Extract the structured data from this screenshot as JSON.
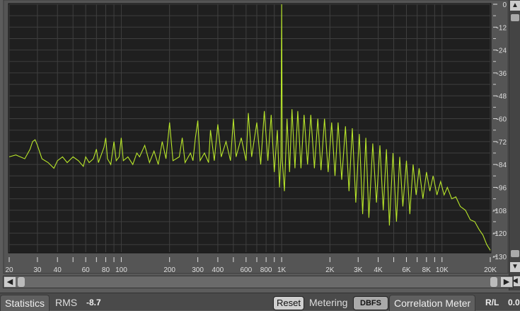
{
  "chart_data": {
    "type": "line",
    "title": "",
    "xscale": "log",
    "xlim": [
      20,
      20000
    ],
    "ylim": [
      -130,
      0
    ],
    "x_tick_labels": [
      {
        "v": 20,
        "t": "20"
      },
      {
        "v": 30,
        "t": "30"
      },
      {
        "v": 40,
        "t": "40"
      },
      {
        "v": 60,
        "t": "60"
      },
      {
        "v": 80,
        "t": "80"
      },
      {
        "v": 100,
        "t": "100"
      },
      {
        "v": 200,
        "t": "200"
      },
      {
        "v": 300,
        "t": "300"
      },
      {
        "v": 400,
        "t": "400"
      },
      {
        "v": 600,
        "t": "600"
      },
      {
        "v": 800,
        "t": "800"
      },
      {
        "v": 1000,
        "t": "1K"
      },
      {
        "v": 2000,
        "t": "2K"
      },
      {
        "v": 3000,
        "t": "3K"
      },
      {
        "v": 4000,
        "t": "4K"
      },
      {
        "v": 6000,
        "t": "6K"
      },
      {
        "v": 8000,
        "t": "8K"
      },
      {
        "v": 10000,
        "t": "10K"
      },
      {
        "v": 20000,
        "t": "20K"
      }
    ],
    "x_minor_ticks": [
      50,
      70,
      90,
      500,
      700,
      900,
      5000,
      7000,
      9000
    ],
    "y_tick_labels": [
      "0",
      "-12",
      "-24",
      "-36",
      "-48",
      "-60",
      "-72",
      "-84",
      "-96",
      "-108",
      "-120",
      "-130"
    ],
    "y_ticks": [
      0,
      -12,
      -24,
      -36,
      -48,
      -60,
      -72,
      -84,
      -96,
      -108,
      -120,
      -130
    ],
    "grid": true,
    "line_color": "#b8e62a",
    "series": [
      {
        "name": "spectrum",
        "points": [
          [
            20,
            -80
          ],
          [
            22,
            -79
          ],
          [
            25,
            -81
          ],
          [
            27,
            -76
          ],
          [
            28,
            -72
          ],
          [
            29,
            -71
          ],
          [
            30,
            -74
          ],
          [
            32,
            -81
          ],
          [
            35,
            -83
          ],
          [
            38,
            -86
          ],
          [
            40,
            -82
          ],
          [
            43,
            -80
          ],
          [
            46,
            -83
          ],
          [
            50,
            -80
          ],
          [
            54,
            -82
          ],
          [
            58,
            -85
          ],
          [
            60,
            -80
          ],
          [
            63,
            -83
          ],
          [
            67,
            -81
          ],
          [
            70,
            -76
          ],
          [
            72,
            -83
          ],
          [
            75,
            -79
          ],
          [
            78,
            -75
          ],
          [
            80,
            -70
          ],
          [
            82,
            -81
          ],
          [
            86,
            -84
          ],
          [
            90,
            -72
          ],
          [
            93,
            -82
          ],
          [
            97,
            -80
          ],
          [
            100,
            -70
          ],
          [
            103,
            -82
          ],
          [
            110,
            -80
          ],
          [
            118,
            -84
          ],
          [
            125,
            -78
          ],
          [
            130,
            -80
          ],
          [
            140,
            -74
          ],
          [
            150,
            -83
          ],
          [
            160,
            -77
          ],
          [
            170,
            -84
          ],
          [
            180,
            -72
          ],
          [
            190,
            -81
          ],
          [
            200,
            -62
          ],
          [
            210,
            -82
          ],
          [
            230,
            -80
          ],
          [
            240,
            -70
          ],
          [
            250,
            -83
          ],
          [
            270,
            -78
          ],
          [
            280,
            -82
          ],
          [
            290,
            -70
          ],
          [
            300,
            -61
          ],
          [
            310,
            -82
          ],
          [
            330,
            -78
          ],
          [
            350,
            -83
          ],
          [
            360,
            -66
          ],
          [
            380,
            -82
          ],
          [
            400,
            -63
          ],
          [
            420,
            -80
          ],
          [
            450,
            -72
          ],
          [
            480,
            -82
          ],
          [
            500,
            -60
          ],
          [
            520,
            -80
          ],
          [
            560,
            -70
          ],
          [
            600,
            -82
          ],
          [
            620,
            -57
          ],
          [
            650,
            -80
          ],
          [
            700,
            -62
          ],
          [
            740,
            -84
          ],
          [
            780,
            -56
          ],
          [
            820,
            -82
          ],
          [
            860,
            -58
          ],
          [
            900,
            -88
          ],
          [
            940,
            -66
          ],
          [
            970,
            -96
          ],
          [
            990,
            -80
          ],
          [
            1000,
            0
          ],
          [
            1010,
            -82
          ],
          [
            1040,
            -98
          ],
          [
            1080,
            -60
          ],
          [
            1120,
            -88
          ],
          [
            1160,
            -55
          ],
          [
            1210,
            -86
          ],
          [
            1260,
            -56
          ],
          [
            1320,
            -86
          ],
          [
            1380,
            -58
          ],
          [
            1450,
            -84
          ],
          [
            1520,
            -58
          ],
          [
            1600,
            -86
          ],
          [
            1680,
            -60
          ],
          [
            1760,
            -87
          ],
          [
            1850,
            -60
          ],
          [
            1950,
            -88
          ],
          [
            2050,
            -62
          ],
          [
            2150,
            -90
          ],
          [
            2250,
            -62
          ],
          [
            2370,
            -92
          ],
          [
            2500,
            -64
          ],
          [
            2630,
            -98
          ],
          [
            2760,
            -65
          ],
          [
            2900,
            -104
          ],
          [
            3050,
            -68
          ],
          [
            3200,
            -110
          ],
          [
            3350,
            -70
          ],
          [
            3500,
            -112
          ],
          [
            3700,
            -73
          ],
          [
            3900,
            -104
          ],
          [
            4100,
            -74
          ],
          [
            4300,
            -108
          ],
          [
            4500,
            -76
          ],
          [
            4700,
            -116
          ],
          [
            4950,
            -78
          ],
          [
            5200,
            -114
          ],
          [
            5450,
            -80
          ],
          [
            5700,
            -106
          ],
          [
            6000,
            -82
          ],
          [
            6300,
            -110
          ],
          [
            6600,
            -84
          ],
          [
            6900,
            -100
          ],
          [
            7200,
            -86
          ],
          [
            7600,
            -102
          ],
          [
            8000,
            -88
          ],
          [
            8400,
            -98
          ],
          [
            8800,
            -90
          ],
          [
            9300,
            -100
          ],
          [
            9800,
            -93
          ],
          [
            10300,
            -100
          ],
          [
            10800,
            -96
          ],
          [
            11500,
            -102
          ],
          [
            12200,
            -101
          ],
          [
            13000,
            -106
          ],
          [
            14000,
            -108
          ],
          [
            15000,
            -113
          ],
          [
            16000,
            -114
          ],
          [
            17000,
            -118
          ],
          [
            18000,
            -121
          ],
          [
            19000,
            -126
          ],
          [
            20000,
            -129
          ]
        ]
      }
    ]
  },
  "statusbar": {
    "statistics_tab": "Statistics",
    "rms_label": "RMS",
    "rms_value": "-8.7",
    "reset_label": "Reset",
    "metering_label": "Metering",
    "metering_mode": "DBFS",
    "correlation_tab": "Correlation Meter",
    "rl_label": "R/L",
    "rl_value": "0.0"
  }
}
